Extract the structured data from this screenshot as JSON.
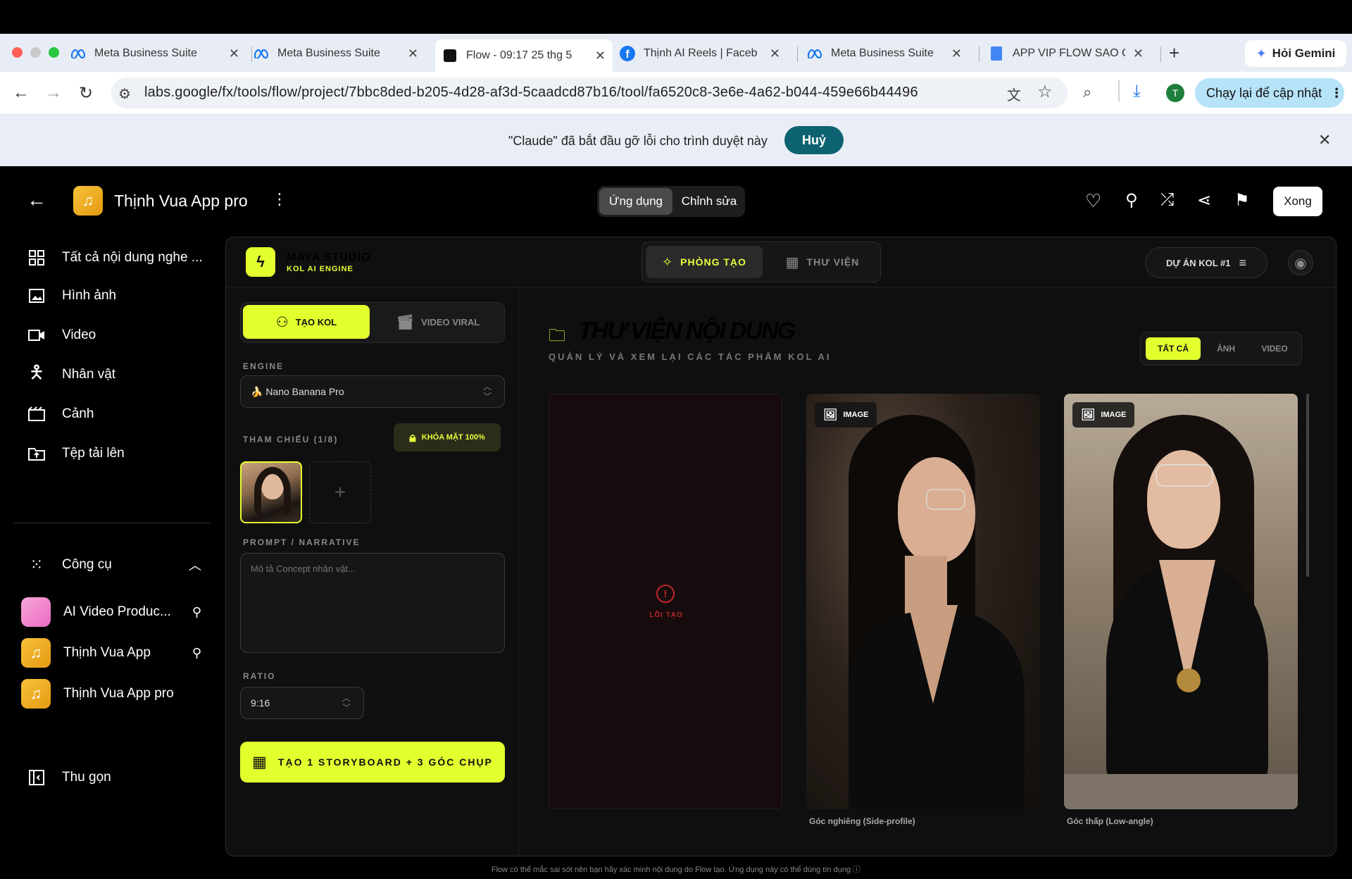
{
  "browser": {
    "tabs": [
      {
        "title": "Meta Business Suite"
      },
      {
        "title": "Meta Business Suite"
      },
      {
        "title": "Flow - 09:17 25 thg 5"
      },
      {
        "title": "Thịnh AI Reels | Faceb"
      },
      {
        "title": "Meta Business Suite"
      },
      {
        "title": "APP VIP FLOW SAO C"
      }
    ],
    "gemini_label": "Hỏi Gemini",
    "url": "labs.google/fx/tools/flow/project/7bbc8ded-b205-4d28-af3d-5caadcd87b16/tool/fa6520c8-3e6e-4a62-b044-459e66b44496",
    "profile_initial": "T",
    "update_label": "Chạy lại để cập nhật",
    "debug_text": "\"Claude\" đã bắt đầu gỡ lỗi cho trình duyệt này",
    "debug_cancel": "Huỷ"
  },
  "header": {
    "project_title": "Thịnh Vua App pro",
    "mode_app": "Ứng dụng",
    "mode_edit": "Chỉnh sửa",
    "done": "Xong"
  },
  "sidebar": {
    "items": [
      {
        "label": "Tất cả nội dung nghe ..."
      },
      {
        "label": "Hình ảnh"
      },
      {
        "label": "Video"
      },
      {
        "label": "Nhân vật"
      },
      {
        "label": "Cảnh"
      },
      {
        "label": "Tệp tải lên"
      }
    ],
    "tools_label": "Công cụ",
    "tools": [
      {
        "label": "AI Video Produc..."
      },
      {
        "label": "Thịnh Vua App"
      },
      {
        "label": "Thịnh Vua App pro"
      }
    ],
    "collapse": "Thu gọn"
  },
  "studio": {
    "brand": "MAYA STUDIO",
    "brand_sub": "KOL AI ENGINE",
    "nav_create": "PHÒNG TẠO",
    "nav_library": "THƯ VIỆN",
    "project": "DỰ ÁN KOL #1",
    "tab_create_kol": "TẠO KOL",
    "tab_viral": "VIDEO VIRAL",
    "engine_label": "ENGINE",
    "engine_value": "🍌 Nano Banana Pro",
    "ref_label": "THAM CHIẾU (1/8)",
    "face_lock": "KHÓA MẶT 100%",
    "prompt_label": "PROMPT / NARRATIVE",
    "prompt_placeholder": "Mô tả Concept nhân vật...",
    "ratio_label": "RATIO",
    "ratio_value": "9:16",
    "generate": "TẠO 1 STORYBOARD + 3 GÓC CHỤP",
    "library_title": "THƯ VIỆN NỘI DUNG",
    "library_sub": "QUẢN LÝ VÀ XEM LẠI CÁC TÁC PHẨM KOL AI",
    "filters": [
      "TẤT CẢ",
      "ẢNH",
      "VIDEO"
    ],
    "error_label": "LỖI TẠO",
    "cards": [
      {
        "badge": "IMAGE",
        "caption": "Góc nghiêng (Side-profile)"
      },
      {
        "badge": "IMAGE",
        "caption": "Góc thấp (Low-angle)"
      }
    ]
  },
  "footer_note": "Flow có thể mắc sai sót nên bạn hãy xác minh nội dung do Flow tạo. Ứng dụng này có thể dùng tín dụng",
  "colors": {
    "accent": "#e4ff2e",
    "debug_button": "#0d6272",
    "error": "#c0262c"
  }
}
